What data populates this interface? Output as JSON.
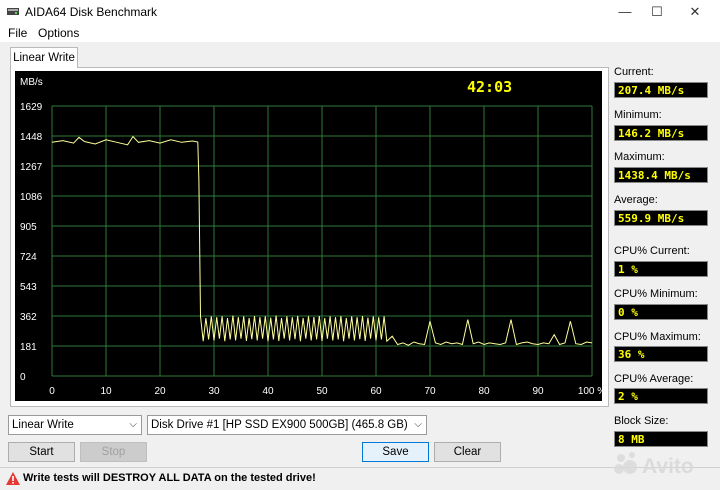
{
  "window": {
    "title": "AIDA64 Disk Benchmark",
    "controls": [
      "—",
      "☐",
      "✕"
    ]
  },
  "menu": [
    "File",
    "Options"
  ],
  "tab": {
    "label": "Linear Write"
  },
  "chart_data": {
    "type": "line",
    "ylabel": "MB/s",
    "timer": "42:03",
    "yticks": [
      "1629",
      "1448",
      "1267",
      "1086",
      "905",
      "724",
      "543",
      "362",
      "181",
      "0"
    ],
    "xticks": [
      "0",
      "10",
      "20",
      "30",
      "40",
      "50",
      "60",
      "70",
      "80",
      "90",
      "100 %"
    ],
    "ylim": [
      0,
      1629
    ],
    "xlim": [
      0,
      100
    ],
    "grid": true,
    "line_color": "#ffff99",
    "series": [
      {
        "x": [
          0,
          2,
          4,
          5,
          6,
          8,
          10,
          12,
          14,
          15,
          16,
          18,
          20,
          22,
          24,
          26,
          27,
          27.2,
          27.5,
          28,
          28.5,
          29,
          29.5,
          30,
          30.5,
          31,
          31.5,
          32,
          32.5,
          33,
          33.5,
          34,
          34.5,
          35,
          35.5,
          36,
          36.5,
          37,
          37.5,
          38,
          38.5,
          39,
          39.5,
          40,
          40.5,
          41,
          41.5,
          42,
          42.5,
          43,
          43.5,
          44,
          44.5,
          45,
          45.5,
          46,
          46.5,
          47,
          47.5,
          48,
          48.5,
          49,
          49.5,
          50,
          50.5,
          51,
          51.5,
          52,
          52.5,
          53,
          53.5,
          54,
          54.5,
          55,
          55.5,
          56,
          56.5,
          57,
          57.5,
          58,
          58.5,
          59,
          59.5,
          60,
          60.5,
          61,
          61.5,
          62,
          63,
          64,
          65,
          66,
          67,
          68,
          69,
          70,
          71,
          72,
          73,
          74,
          75,
          76,
          77,
          78,
          79,
          80,
          81,
          82,
          83,
          84,
          85,
          86,
          87,
          88,
          89,
          90,
          91,
          92,
          93,
          94,
          95,
          96,
          97,
          98,
          99,
          100
        ],
        "values": [
          1410,
          1420,
          1405,
          1440,
          1415,
          1400,
          1425,
          1410,
          1395,
          1445,
          1410,
          1420,
          1405,
          1425,
          1410,
          1418,
          1412,
          1180,
          360,
          210,
          350,
          220,
          360,
          215,
          355,
          225,
          360,
          210,
          350,
          220,
          365,
          215,
          355,
          225,
          360,
          212,
          350,
          222,
          362,
          215,
          355,
          225,
          360,
          210,
          352,
          220,
          365,
          212,
          350,
          225,
          360,
          215,
          355,
          222,
          362,
          210,
          350,
          225,
          360,
          215,
          356,
          220,
          362,
          212,
          350,
          225,
          360,
          215,
          355,
          220,
          362,
          210,
          350,
          225,
          360,
          215,
          355,
          222,
          362,
          212,
          352,
          225,
          360,
          215,
          355,
          220,
          360,
          210,
          240,
          190,
          200,
          185,
          205,
          195,
          190,
          330,
          200,
          190,
          205,
          195,
          200,
          190,
          340,
          195,
          205,
          190,
          200,
          195,
          190,
          200,
          340,
          190,
          200,
          205,
          195,
          190,
          200,
          195,
          250,
          190,
          200,
          330,
          195,
          190,
          205,
          200
        ]
      }
    ]
  },
  "stats": {
    "current": {
      "label": "Current:",
      "value": "207.4 MB/s"
    },
    "minimum": {
      "label": "Minimum:",
      "value": "146.2 MB/s"
    },
    "maximum": {
      "label": "Maximum:",
      "value": "1438.4 MB/s"
    },
    "average": {
      "label": "Average:",
      "value": "559.9 MB/s"
    },
    "cpu_current": {
      "label": "CPU% Current:",
      "value": "1 %"
    },
    "cpu_minimum": {
      "label": "CPU% Minimum:",
      "value": "0 %"
    },
    "cpu_maximum": {
      "label": "CPU% Maximum:",
      "value": "36 %"
    },
    "cpu_average": {
      "label": "CPU% Average:",
      "value": "2 %"
    },
    "block_size": {
      "label": "Block Size:",
      "value": "8 MB"
    }
  },
  "controls": {
    "test_select": "Linear Write",
    "drive_select": "Disk Drive #1  [HP SSD EX900 500GB]  (465.8 GB)",
    "start": "Start",
    "stop": "Stop",
    "save": "Save",
    "clear": "Clear"
  },
  "status": {
    "warning": "Write tests will DESTROY ALL DATA on the tested drive!"
  },
  "watermark": {
    "text": "Avito"
  },
  "colors": {
    "chart_bg": "#000000",
    "grid": "#2f7a3a",
    "line": "#ffff99",
    "value_text": "#ffff00",
    "timer": "#ffff00"
  }
}
